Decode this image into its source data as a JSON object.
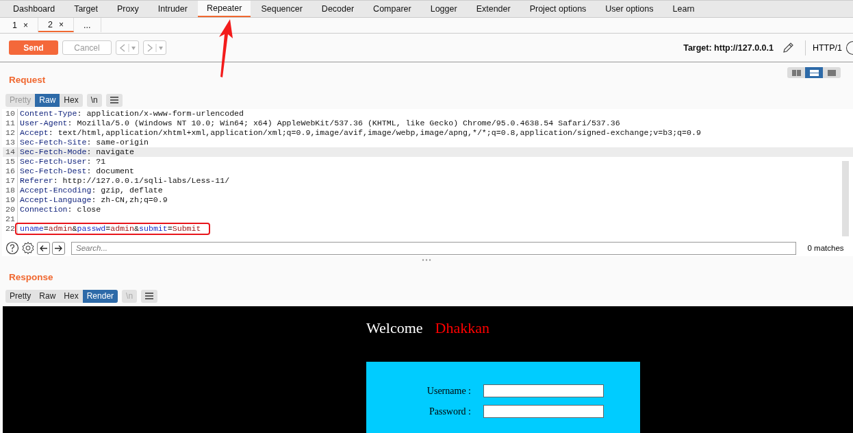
{
  "main_tabs": [
    {
      "label": "Dashboard",
      "selected": false
    },
    {
      "label": "Target",
      "selected": false
    },
    {
      "label": "Proxy",
      "selected": false
    },
    {
      "label": "Intruder",
      "selected": false
    },
    {
      "label": "Repeater",
      "selected": true
    },
    {
      "label": "Sequencer",
      "selected": false
    },
    {
      "label": "Decoder",
      "selected": false
    },
    {
      "label": "Comparer",
      "selected": false
    },
    {
      "label": "Logger",
      "selected": false
    },
    {
      "label": "Extender",
      "selected": false
    },
    {
      "label": "Project options",
      "selected": false
    },
    {
      "label": "User options",
      "selected": false
    },
    {
      "label": "Learn",
      "selected": false
    }
  ],
  "request_tabs": [
    {
      "label": "1",
      "close": "×",
      "selected": false
    },
    {
      "label": "2",
      "close": "×",
      "selected": true
    },
    {
      "label": "...",
      "selected": false
    }
  ],
  "toolbar": {
    "send": "Send",
    "cancel": "Cancel",
    "cancel_disabled": true,
    "target": "Target: http://127.0.0.1",
    "protocol": "HTTP/1"
  },
  "layout_buttons": [
    {
      "kind": "split",
      "selected": false
    },
    {
      "kind": "stacked",
      "selected": true
    },
    {
      "kind": "single",
      "selected": false
    }
  ],
  "request": {
    "title": "Request",
    "view_tabs": [
      {
        "label": "Pretty",
        "selected": false,
        "disabled": true
      },
      {
        "label": "Raw",
        "selected": true,
        "disabled": false
      },
      {
        "label": "Hex",
        "selected": false,
        "disabled": false
      }
    ],
    "newline": {
      "label": "\\n",
      "disabled": false
    },
    "lines": [
      {
        "number": "10",
        "selected": false,
        "highlighted": false,
        "tokens": [
          {
            "kind": "name",
            "text": "Content-Type"
          },
          {
            "kind": "text",
            "text": ": application/x-www-form-urlencoded"
          }
        ]
      },
      {
        "number": "11",
        "selected": false,
        "highlighted": false,
        "tokens": [
          {
            "kind": "name",
            "text": "User-Agent"
          },
          {
            "kind": "text",
            "text": ": Mozilla/5.0 (Windows NT 10.0; Win64; x64) AppleWebKit/537.36 (KHTML, like Gecko) Chrome/95.0.4638.54 Safari/537.36"
          }
        ]
      },
      {
        "number": "12",
        "selected": false,
        "highlighted": false,
        "tokens": [
          {
            "kind": "name",
            "text": "Accept"
          },
          {
            "kind": "text",
            "text": ": text/html,application/xhtml+xml,application/xml;q=0.9,image/avif,image/webp,image/apng,*/*;q=0.8,application/signed-exchange;v=b3;q=0.9"
          }
        ]
      },
      {
        "number": "13",
        "selected": false,
        "highlighted": false,
        "tokens": [
          {
            "kind": "name",
            "text": "Sec-Fetch-Site"
          },
          {
            "kind": "text",
            "text": ": same-origin"
          }
        ]
      },
      {
        "number": "14",
        "selected": true,
        "highlighted": false,
        "tokens": [
          {
            "kind": "name",
            "text": "Sec-Fetch-Mode"
          },
          {
            "kind": "text",
            "text": ": navigate"
          }
        ]
      },
      {
        "number": "15",
        "selected": false,
        "highlighted": false,
        "tokens": [
          {
            "kind": "name",
            "text": "Sec-Fetch-User"
          },
          {
            "kind": "text",
            "text": ": ?1"
          }
        ]
      },
      {
        "number": "16",
        "selected": false,
        "highlighted": false,
        "tokens": [
          {
            "kind": "name",
            "text": "Sec-Fetch-Dest"
          },
          {
            "kind": "text",
            "text": ": document"
          }
        ]
      },
      {
        "number": "17",
        "selected": false,
        "highlighted": false,
        "tokens": [
          {
            "kind": "name",
            "text": "Referer"
          },
          {
            "kind": "text",
            "text": ": http://127.0.0.1/sqli-labs/Less-11/"
          }
        ]
      },
      {
        "number": "18",
        "selected": false,
        "highlighted": false,
        "tokens": [
          {
            "kind": "name",
            "text": "Accept-Encoding"
          },
          {
            "kind": "text",
            "text": ": gzip, deflate"
          }
        ]
      },
      {
        "number": "19",
        "selected": false,
        "highlighted": false,
        "tokens": [
          {
            "kind": "name",
            "text": "Accept-Language"
          },
          {
            "kind": "text",
            "text": ": zh-CN,zh;q=0.9"
          }
        ]
      },
      {
        "number": "20",
        "selected": false,
        "highlighted": false,
        "tokens": [
          {
            "kind": "name",
            "text": "Connection"
          },
          {
            "kind": "text",
            "text": ": close"
          }
        ]
      },
      {
        "number": "21",
        "selected": false,
        "highlighted": false
      },
      {
        "number": "22",
        "selected": false,
        "highlighted": true,
        "tokens": [
          {
            "kind": "key",
            "text": "uname"
          },
          {
            "kind": "text",
            "text": "="
          },
          {
            "kind": "value",
            "text": "admin"
          },
          {
            "kind": "text",
            "text": "&"
          },
          {
            "kind": "key",
            "text": "passwd"
          },
          {
            "kind": "text",
            "text": "="
          },
          {
            "kind": "value",
            "text": "admin"
          },
          {
            "kind": "text",
            "text": "&"
          },
          {
            "kind": "key",
            "text": "submit"
          },
          {
            "kind": "text",
            "text": "="
          },
          {
            "kind": "value",
            "text": "Submit"
          }
        ]
      }
    ],
    "search": {
      "placeholder": "Search...",
      "matches": "0 matches"
    }
  },
  "response": {
    "title": "Response",
    "view_tabs": [
      {
        "label": "Pretty",
        "selected": false,
        "disabled": false
      },
      {
        "label": "Raw",
        "selected": false,
        "disabled": false
      },
      {
        "label": "Hex",
        "selected": false,
        "disabled": false
      },
      {
        "label": "Render",
        "selected": true,
        "disabled": false
      }
    ],
    "newline": {
      "label": "\\n",
      "disabled": true
    },
    "render": {
      "welcome": "Welcome",
      "name": "Dhakkan",
      "fields": [
        {
          "label": "Username :"
        },
        {
          "label": "Password :"
        }
      ]
    }
  }
}
